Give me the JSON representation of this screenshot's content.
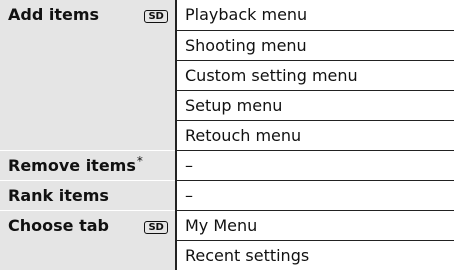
{
  "table": {
    "rows": [
      {
        "label": "Add items",
        "badge": "SD",
        "values": [
          "Playback menu",
          "Shooting menu",
          "Custom setting menu",
          "Setup menu",
          "Retouch menu"
        ]
      },
      {
        "label": "Remove items",
        "mark": "*",
        "values": [
          "–"
        ]
      },
      {
        "label": "Rank items",
        "values": [
          "–"
        ]
      },
      {
        "label": "Choose tab",
        "badge": "SD",
        "values": [
          "My Menu",
          "Recent settings"
        ]
      }
    ]
  }
}
